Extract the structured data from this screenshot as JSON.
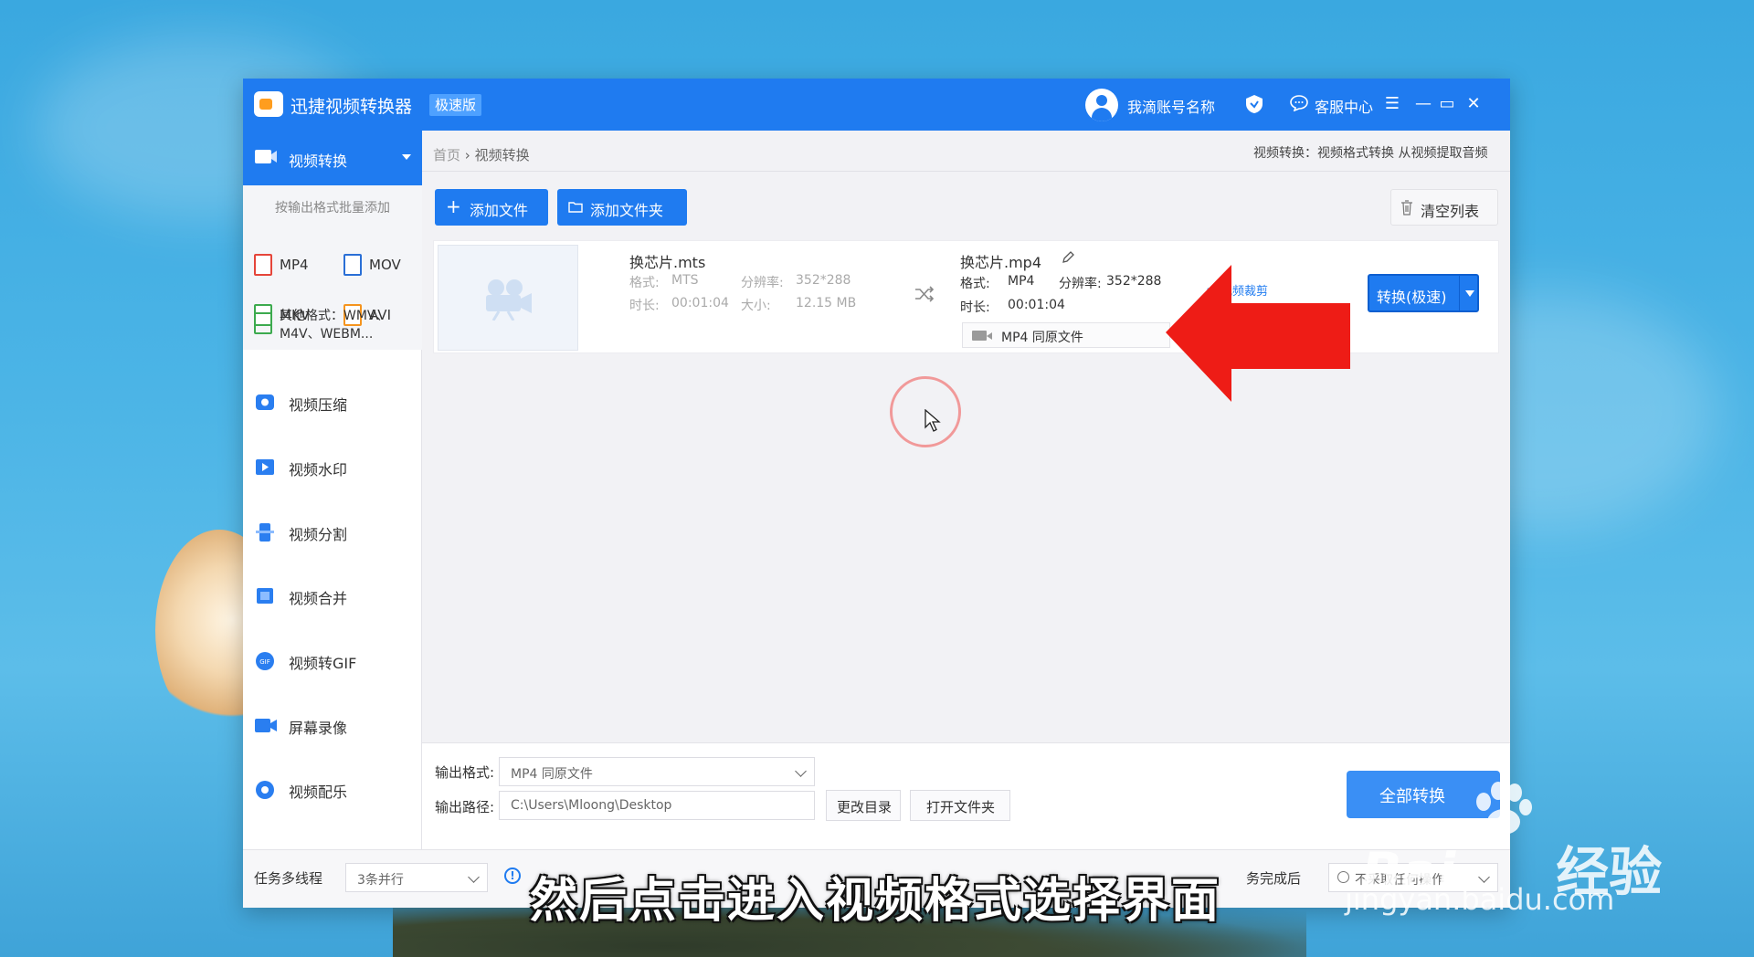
{
  "titlebar": {
    "app_title": "迅捷视频转换器",
    "edition_badge": "极速版",
    "user_name": "我滴账号名称",
    "service_label": "客服中心",
    "menu_symbol": "☰",
    "minimize_symbol": "—",
    "maximize_symbol": "▭",
    "close_symbol": "✕"
  },
  "sidebar": {
    "active_item": "视频转换",
    "batch_hint": "按输出格式批量添加",
    "formats": [
      {
        "label": "MP4",
        "color": "#e5453a"
      },
      {
        "label": "MOV",
        "color": "#2a6fd6"
      },
      {
        "label": "MKV",
        "color": "#3caa4e"
      },
      {
        "label": "AVI",
        "color": "#f5941e"
      }
    ],
    "other_formats": "其他格式：WMV、M4V、WEBM...",
    "nav_items": [
      {
        "label": "视频压缩",
        "icon": "compress-icon"
      },
      {
        "label": "视频水印",
        "icon": "watermark-icon"
      },
      {
        "label": "视频分割",
        "icon": "split-icon"
      },
      {
        "label": "视频合并",
        "icon": "merge-icon"
      },
      {
        "label": "视频转GIF",
        "icon": "gif-icon"
      },
      {
        "label": "屏幕录像",
        "icon": "record-icon"
      },
      {
        "label": "视频配乐",
        "icon": "music-icon"
      }
    ]
  },
  "breadcrumb": {
    "home": "首页",
    "separator": "›",
    "current": "视频转换"
  },
  "top_hint": "视频转换：视频格式转换 从视频提取音频",
  "toolbar": {
    "add_file": "添加文件",
    "add_folder": "添加文件夹",
    "clear_list": "清空列表"
  },
  "file": {
    "source_name": "换芯片.mts",
    "format_label": "格式:",
    "source_format": "MTS",
    "resolution_label": "分辨率:",
    "source_resolution": "352*288",
    "duration_label": "时长:",
    "source_duration": "00:01:04",
    "size_label": "大小:",
    "source_size": "12.15 MB",
    "output_name": "换芯片.mp4",
    "output_format": "MP4",
    "output_resolution": "352*288",
    "output_duration": "00:01:04",
    "output_select": "MP4  同原文件",
    "cut_link": "视频裁剪",
    "convert_button": "转换(极速)"
  },
  "bottom": {
    "output_format_label": "输出格式:",
    "output_format_value": "MP4  同原文件",
    "output_path_label": "输出路径:",
    "output_path_value": "C:\\Users\\Mloong\\Desktop",
    "change_dir": "更改目录",
    "open_folder": "打开文件夹",
    "convert_all": "全部转换"
  },
  "status": {
    "threads_label": "任务多线程",
    "threads_value": "3条并行",
    "after_label": "务完成后",
    "after_value": "不采取任何操作"
  },
  "caption": "然后点击进入视频格式选择界面",
  "watermark": {
    "brand": "Bai",
    "brand_cn": "经验",
    "url": "jingyan.baidu.com"
  },
  "colors": {
    "primary": "#1f7bf0",
    "arrow": "#ee1c16"
  }
}
